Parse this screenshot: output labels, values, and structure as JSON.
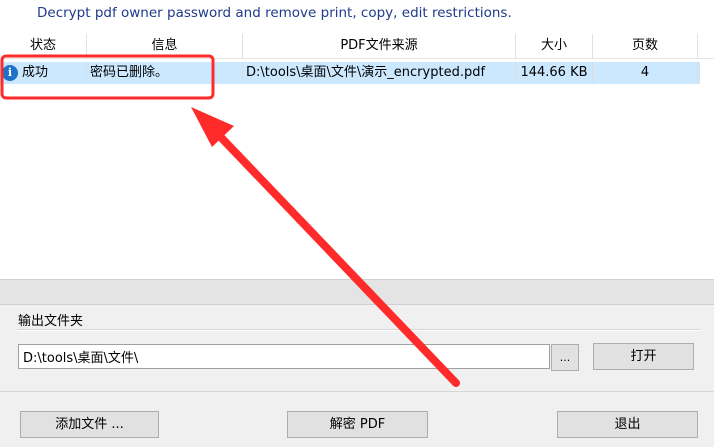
{
  "subtitle": "Decrypt pdf owner password and remove print, copy, edit  restrictions.",
  "table": {
    "columns": [
      "状态",
      "信息",
      "PDF文件来源",
      "大小",
      "页数"
    ],
    "rows": [
      {
        "status_icon": "info-icon",
        "status": "成功",
        "info": "密码已删除。",
        "source": "D:\\tools\\桌面\\文件\\演示_encrypted.pdf",
        "size": "144.66 KB",
        "pages": "4"
      }
    ]
  },
  "output": {
    "label": "输出文件夹",
    "path": "D:\\tools\\桌面\\文件\\",
    "browse_label": "...",
    "open_label": "打开"
  },
  "buttons": {
    "add_files": "添加文件 ...",
    "decrypt": "解密 PDF",
    "exit": "退出"
  },
  "annotation": {
    "color": "#ff2a2a"
  }
}
